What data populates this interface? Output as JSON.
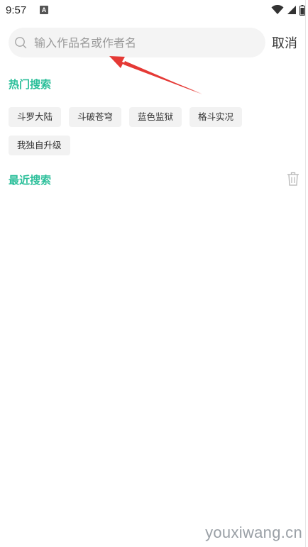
{
  "status_bar": {
    "time": "9:57",
    "notification_letter": "A",
    "icons": [
      "wifi-icon",
      "signal-icon",
      "battery-icon"
    ]
  },
  "search": {
    "placeholder": "输入作品名或作者名",
    "value": "",
    "cancel_label": "取消"
  },
  "hot_search": {
    "title": "热门搜索",
    "tags": [
      "斗罗大陆",
      "斗破苍穹",
      "蓝色监狱",
      "格斗实况",
      "我独自升级"
    ]
  },
  "recent_search": {
    "title": "最近搜索"
  },
  "watermark": "youxiwang.cn",
  "colors": {
    "accent": "#2bbf9a",
    "annotation_arrow": "#e53935"
  }
}
